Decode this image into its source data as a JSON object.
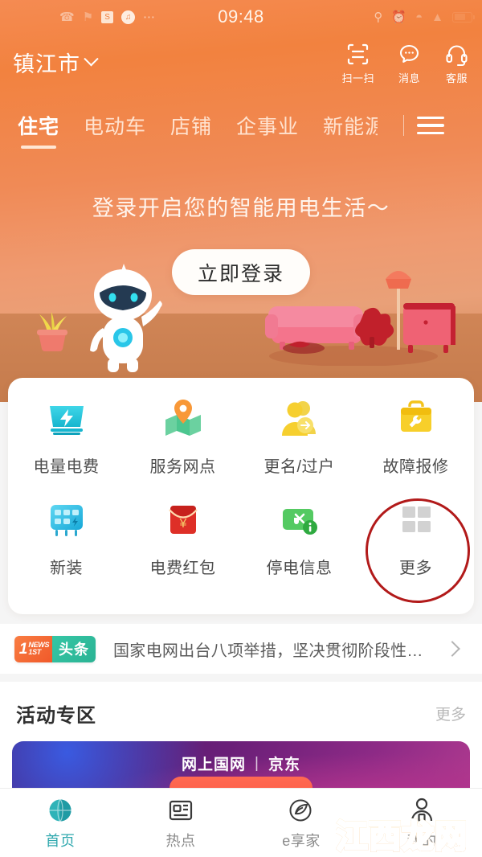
{
  "statusbar": {
    "time": "09:48",
    "left_icons": [
      "phone-icon",
      "bell-icon",
      "s-app-icon",
      "music-app-icon",
      "more-dots-icon"
    ],
    "right_icons": [
      "location-icon",
      "alarm-icon",
      "wifi-icon",
      "signal-icon",
      "battery-icon"
    ],
    "dots": "⋯"
  },
  "header": {
    "city": "镇江市",
    "actions": [
      {
        "label": "扫一扫",
        "icon": "scan-icon"
      },
      {
        "label": "消息",
        "icon": "message-icon"
      },
      {
        "label": "客服",
        "icon": "headset-icon"
      }
    ]
  },
  "tabs": {
    "items": [
      {
        "label": "住宅",
        "active": true
      },
      {
        "label": "电动车",
        "active": false
      },
      {
        "label": "店铺",
        "active": false
      },
      {
        "label": "企事业",
        "active": false
      },
      {
        "label": "新能源",
        "active": false
      }
    ],
    "menu_icon": "hamburger-menu-icon"
  },
  "hero": {
    "title": "登录开启您的智能用电生活～",
    "login_button": "立即登录",
    "illustration": [
      "robot-mascot",
      "potted-plant",
      "sofa",
      "floor-lamp",
      "cabinet",
      "rug"
    ]
  },
  "services": [
    {
      "label": "电量电费",
      "icon": "electric-meter-icon",
      "color": "#2fc2d4"
    },
    {
      "label": "服务网点",
      "icon": "map-pin-icon",
      "color": "#5fc78f"
    },
    {
      "label": "更名/过户",
      "icon": "user-transfer-icon",
      "color": "#f5cf3f"
    },
    {
      "label": "故障报修",
      "icon": "toolbox-repair-icon",
      "color": "#f5c51f"
    },
    {
      "label": "新装",
      "icon": "switchboard-icon",
      "color": "#3fc0e8"
    },
    {
      "label": "电费红包",
      "icon": "red-envelope-icon",
      "color": "#e0392c"
    },
    {
      "label": "停电信息",
      "icon": "power-off-info-icon",
      "color": "#4cc55f"
    },
    {
      "label": "更多",
      "icon": "grid-more-icon",
      "color": "#cfcfcf"
    }
  ],
  "annotation": {
    "shape": "red-ellipse",
    "target": "更多",
    "color": "#b21a1a"
  },
  "news": {
    "badge_left_top": "NEWS",
    "badge_left_num": "1",
    "badge_left_bottom": "1ST",
    "badge_right": "头条",
    "headline": "国家电网出台八项举措，坚决贯彻阶段性…",
    "chevron": "chevron-right-icon"
  },
  "activity": {
    "title": "活动专区",
    "more": "更多",
    "promo_brand_left": "网上国网",
    "promo_separator": "|",
    "promo_brand_right": "京东"
  },
  "bottom_nav": [
    {
      "label": "首页",
      "icon": "home-globe-icon",
      "active": true
    },
    {
      "label": "热点",
      "icon": "news-hot-icon",
      "active": false
    },
    {
      "label": "e享家",
      "icon": "e-leaf-icon",
      "active": false
    },
    {
      "label": "我的",
      "icon": "profile-person-icon",
      "active": false
    }
  ],
  "watermark": {
    "text": "江西龙网"
  },
  "colors": {
    "brand_orange": "#f08040",
    "active_teal": "#2fa8ae",
    "annotation_red": "#b21a1a",
    "news_green": "#2bb394"
  }
}
